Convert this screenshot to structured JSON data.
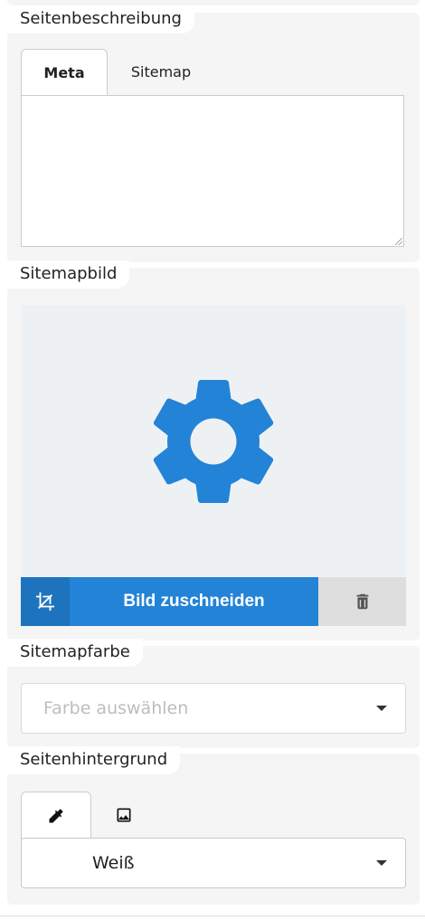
{
  "page_description": {
    "label": "Seitenbeschreibung",
    "tabs": [
      {
        "label": "Meta",
        "active": true
      },
      {
        "label": "Sitemap",
        "active": false
      }
    ],
    "text_value": ""
  },
  "sitemap_image": {
    "label": "Sitemapbild",
    "placeholder_icon": "gear-icon",
    "crop_icon": "crop-icon",
    "crop_button_label": "Bild zuschneiden",
    "delete_icon": "trash-icon",
    "accent_color": "#2383d6"
  },
  "sitemap_color": {
    "label": "Sitemapfarbe",
    "placeholder": "Farbe auswählen"
  },
  "page_background": {
    "label": "Seitenhintergrund",
    "tabs": [
      {
        "icon": "eyedropper-icon",
        "active": true
      },
      {
        "icon": "image-icon",
        "active": false
      }
    ],
    "selected_value": "Weiß"
  }
}
